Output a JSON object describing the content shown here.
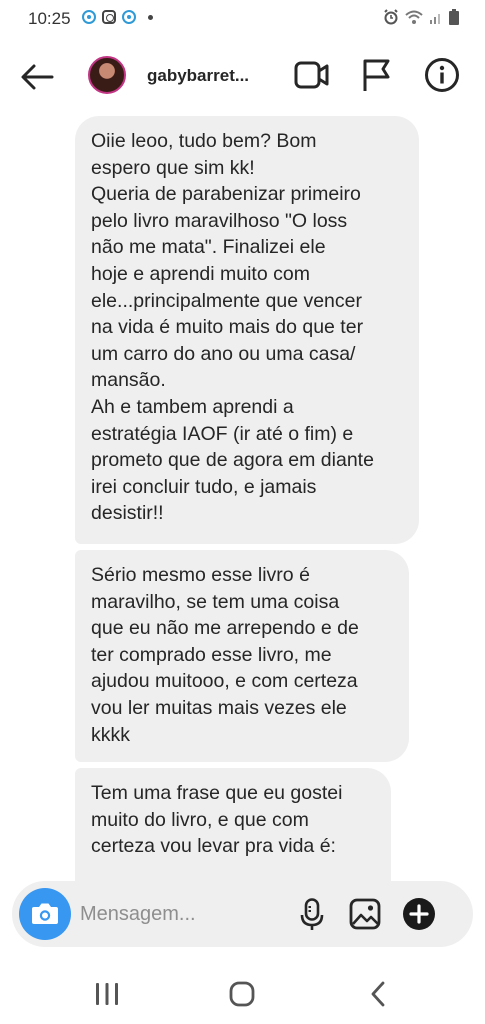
{
  "status_bar": {
    "time": "10:25"
  },
  "header": {
    "username": "gabybarret..."
  },
  "messages": [
    {
      "text": "Oiie leoo, tudo bem? Bom\nespero que sim kk!\nQueria de parabenizar primeiro\npelo livro maravilhoso \"O loss\nnão me mata\". Finalizei ele\nhoje e aprendi muito com\nele...principalmente que vencer\nna vida é muito mais do que ter\num carro do ano ou uma casa/\nmansão.\nAh e tambem aprendi a\nestratégia IAOF (ir até o fim) e\nprometo que de agora em diante\nirei concluir tudo, e jamais\ndesistir!!"
    },
    {
      "text": "Sério mesmo esse livro é\nmaravilho, se tem uma coisa\nque eu não me arrependo e de\nter comprado esse livro, me\najudou muitooo, e com certeza\nvou ler muitas mais vezes ele\nkkkk"
    },
    {
      "text": "Tem uma frase que eu gostei\nmuito do livro, e que com\ncerteza vou levar pra vida é:"
    }
  ],
  "composer": {
    "placeholder": "Mensagem..."
  },
  "colors": {
    "accent": "#3897f0",
    "bubble": "#efefef",
    "text": "#262626"
  },
  "icons": {
    "back": "arrow-left",
    "video": "video-camera",
    "flag": "flag",
    "info": "info-circle",
    "camera": "camera",
    "mic": "microphone",
    "gallery": "image",
    "plus": "plus-circle"
  }
}
